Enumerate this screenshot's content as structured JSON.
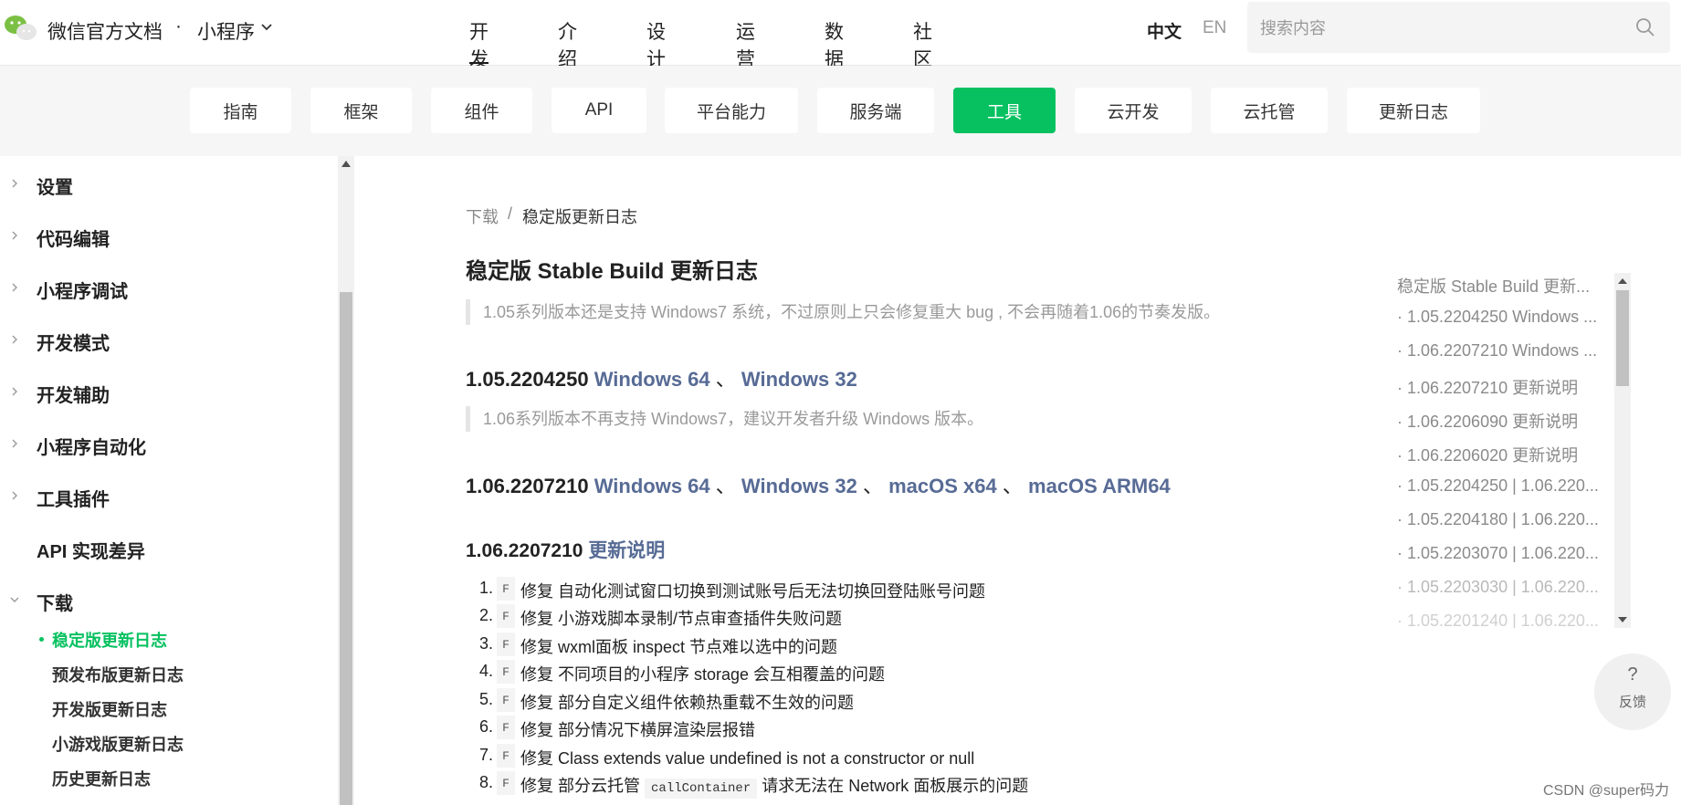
{
  "header": {
    "brand": "微信官方文档",
    "dot": "·",
    "product": "小程序",
    "nav": [
      {
        "label": "开发"
      },
      {
        "label": "介绍"
      },
      {
        "label": "设计"
      },
      {
        "label": "运营"
      },
      {
        "label": "数据"
      },
      {
        "label": "社区"
      }
    ],
    "lang_zh": "中文",
    "lang_en": "EN",
    "search_placeholder": "搜索内容"
  },
  "subnav": [
    {
      "label": "指南"
    },
    {
      "label": "框架"
    },
    {
      "label": "组件"
    },
    {
      "label": "API"
    },
    {
      "label": "平台能力"
    },
    {
      "label": "服务端"
    },
    {
      "label": "工具"
    },
    {
      "label": "云开发"
    },
    {
      "label": "云托管"
    },
    {
      "label": "更新日志"
    }
  ],
  "sidebar": {
    "items": [
      {
        "label": "设置"
      },
      {
        "label": "代码编辑"
      },
      {
        "label": "小程序调试"
      },
      {
        "label": "开发模式"
      },
      {
        "label": "开发辅助"
      },
      {
        "label": "小程序自动化"
      },
      {
        "label": "工具插件"
      },
      {
        "label": "API 实现差异"
      },
      {
        "label": "下载"
      }
    ],
    "subitems": [
      {
        "label": "稳定版更新日志"
      },
      {
        "label": "预发布版更新日志"
      },
      {
        "label": "开发版更新日志"
      },
      {
        "label": "小游戏版更新日志"
      },
      {
        "label": "历史更新日志"
      }
    ]
  },
  "content": {
    "breadcrumb": {
      "parent": "下载",
      "sep": "/",
      "current": "稳定版更新日志"
    },
    "title": "稳定版 Stable Build 更新日志",
    "note1": "1.05系列版本还是支持 Windows7 系统，不过原则上只会修复重大 bug , 不会再随着1.06的节奏发版。",
    "v1": {
      "ver": "1.05.2204250",
      "win64": "Windows 64",
      "sep": "、",
      "win32": "Windows 32"
    },
    "note2": "1.06系列版本不再支持 Windows7，建议开发者升级 Windows 版本。",
    "v2": {
      "ver": "1.06.2207210",
      "win64": "Windows 64",
      "sep": "、",
      "win32": "Windows 32",
      "mac64": "macOS x64",
      "arm": "macOS ARM64"
    },
    "v3": {
      "ver": "1.06.2207210",
      "notes": "更新说明"
    },
    "fix_tag": "F",
    "list": [
      {
        "num": "1.",
        "text": "修复 自动化测试窗口切换到测试账号后无法切换回登陆账号问题"
      },
      {
        "num": "2.",
        "text": "修复 小游戏脚本录制/节点审查插件失败问题"
      },
      {
        "num": "3.",
        "text": "修复 wxml面板 inspect 节点难以选中的问题"
      },
      {
        "num": "4.",
        "text": "修复 不同项目的小程序 storage 会互相覆盖的问题"
      },
      {
        "num": "5.",
        "text": "修复 部分自定义组件依赖热重载不生效的问题"
      },
      {
        "num": "6.",
        "text": "修复 部分情况下横屏渲染层报错"
      },
      {
        "num": "7.",
        "text": "修复 Class extends value undefined is not a constructor or null"
      }
    ],
    "item8": {
      "num": "8.",
      "pre": "修复 部分云托管 ",
      "code": "callContainer",
      "post": " 请求无法在 Network 面板展示的问题"
    }
  },
  "toc": {
    "items": [
      {
        "label": "稳定版 Stable Build 更新..."
      },
      {
        "label": "· 1.05.2204250 Windows ..."
      },
      {
        "label": "· 1.06.2207210 Windows ..."
      },
      {
        "label": "· 1.06.2207210 更新说明"
      },
      {
        "label": "· 1.06.2206090 更新说明"
      },
      {
        "label": "· 1.06.2206020 更新说明"
      },
      {
        "label": "· 1.05.2204250 | 1.06.220..."
      },
      {
        "label": "· 1.05.2204180 | 1.06.220..."
      },
      {
        "label": "· 1.05.2203070 | 1.06.220..."
      },
      {
        "label": "· 1.05.2203030 | 1.06.220..."
      },
      {
        "label": "· 1.05.2201240 | 1.06.220..."
      }
    ]
  },
  "feedback": {
    "icon": "?",
    "label": "反馈"
  },
  "watermark": "CSDN @super码力",
  "colors": {
    "accent": "#07c160",
    "link": "#576b95"
  }
}
